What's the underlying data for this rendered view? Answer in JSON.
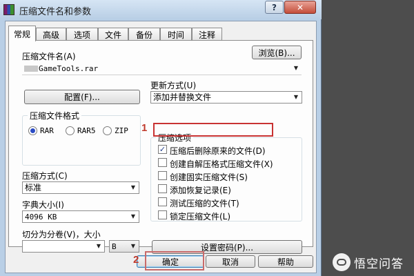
{
  "window": {
    "title": "压缩文件名和参数",
    "help_caption": "?",
    "close_caption": "✕",
    "app_icon": "winrar-books-icon"
  },
  "tabs": [
    {
      "label": "常规",
      "active": true
    },
    {
      "label": "高级"
    },
    {
      "label": "选项"
    },
    {
      "label": "文件"
    },
    {
      "label": "备份"
    },
    {
      "label": "时间"
    },
    {
      "label": "注释"
    }
  ],
  "general": {
    "archive_name_label": "压缩文件名(A)",
    "archive_name_value": "GameTools.rar",
    "browse_button": "浏览(B)...",
    "update_mode_label": "更新方式(U)",
    "update_mode_value": "添加并替换文件",
    "profiles_button": "配置(F)...",
    "format_group_title": "压缩文件格式",
    "formats": [
      {
        "label": "RAR",
        "selected": true
      },
      {
        "label": "RAR5",
        "selected": false
      },
      {
        "label": "ZIP",
        "selected": false
      }
    ],
    "method_label": "压缩方式(C)",
    "method_value": "标准",
    "dict_label": "字典大小(I)",
    "dict_value": "4096 KB",
    "split_label": "切分为分卷(V)，大小",
    "split_value": "",
    "split_unit": "B",
    "options_group_title": "压缩选项",
    "options": [
      {
        "label": "压缩后删除原来的文件(D)",
        "checked": true
      },
      {
        "label": "创建自解压格式压缩文件(X)",
        "checked": false
      },
      {
        "label": "创建固实压缩文件(S)",
        "checked": false
      },
      {
        "label": "添加恢复记录(E)",
        "checked": false
      },
      {
        "label": "测试压缩的文件(T)",
        "checked": false
      },
      {
        "label": "锁定压缩文件(L)",
        "checked": false
      }
    ],
    "set_password_button": "设置密码(P)..."
  },
  "footer": {
    "ok_button": "确定",
    "cancel_button": "取消",
    "help_button": "帮助"
  },
  "annotations": {
    "marker_1": "1",
    "marker_2": "2",
    "color": "#c83232"
  },
  "watermark": {
    "text": "悟空问答"
  },
  "colors": {
    "title_bar": "#b8cee5",
    "dialog_bg": "#f0f0f0",
    "outer_bg": "#4d4d4d"
  }
}
